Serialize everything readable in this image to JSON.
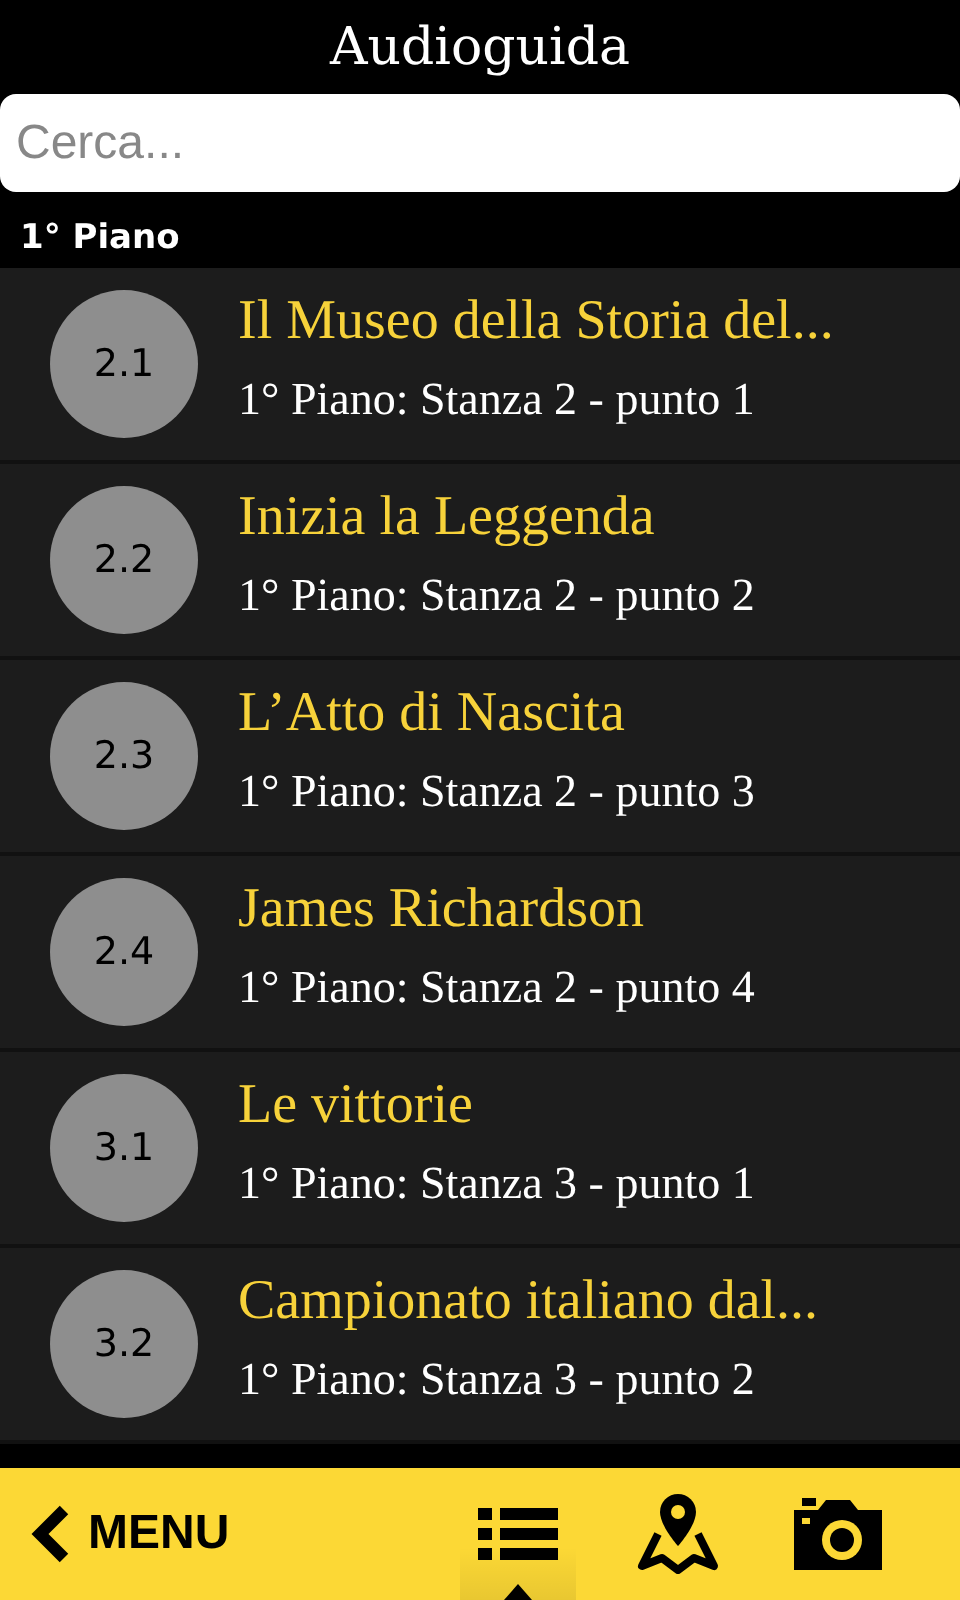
{
  "title": "Audioguida",
  "search": {
    "placeholder": "Cerca..."
  },
  "section": "1° Piano",
  "items": [
    {
      "number": "2.1",
      "title": "Il Museo della Storia del...",
      "subtitle": "1° Piano: Stanza 2 - punto 1"
    },
    {
      "number": "2.2",
      "title": "Inizia la Leggenda",
      "subtitle": "1° Piano: Stanza 2 - punto 2"
    },
    {
      "number": "2.3",
      "title": "L’Atto di Nascita",
      "subtitle": "1° Piano: Stanza 2 - punto 3"
    },
    {
      "number": "2.4",
      "title": "James Richardson",
      "subtitle": "1° Piano: Stanza 2 - punto 4"
    },
    {
      "number": "3.1",
      "title": "Le vittorie",
      "subtitle": "1° Piano: Stanza 3 - punto 1"
    },
    {
      "number": "3.2",
      "title": "Campionato italiano dal...",
      "subtitle": "1° Piano: Stanza 3 - punto 2"
    }
  ],
  "bottom_bar": {
    "back_label": "MENU",
    "tabs": [
      {
        "kind": "list",
        "selected": true
      },
      {
        "kind": "map",
        "selected": false
      },
      {
        "kind": "camera",
        "selected": false
      }
    ]
  }
}
